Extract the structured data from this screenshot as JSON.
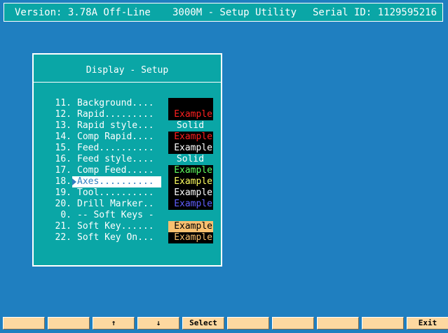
{
  "header": {
    "version": "Version: 3.78A Off-Line",
    "title": "3000M - Setup Utility",
    "serial": "Serial ID: 1129595216"
  },
  "panel": {
    "title": "Display - Setup",
    "items": [
      {
        "num": "11.",
        "label": "Background....",
        "sample_text": "",
        "sample_fg": "#000000",
        "sample_bg": "#000000",
        "selected": false
      },
      {
        "num": "12.",
        "label": "Rapid.........",
        "sample_text": "Example",
        "sample_fg": "#ff2020",
        "sample_bg": "#000000",
        "selected": false
      },
      {
        "num": "13.",
        "label": "Rapid style...",
        "sample_text": "Solid",
        "sample_fg": "#ffffff",
        "sample_bg": "",
        "selected": false
      },
      {
        "num": "14.",
        "label": "Comp Rapid....",
        "sample_text": "Example",
        "sample_fg": "#ff2020",
        "sample_bg": "#000000",
        "selected": false
      },
      {
        "num": "15.",
        "label": "Feed..........",
        "sample_text": "Example",
        "sample_fg": "#ffffff",
        "sample_bg": "#000000",
        "selected": false
      },
      {
        "num": "16.",
        "label": "Feed style....",
        "sample_text": "Solid",
        "sample_fg": "#ffffff",
        "sample_bg": "",
        "selected": false
      },
      {
        "num": "17.",
        "label": "Comp Feed.....",
        "sample_text": "Example",
        "sample_fg": "#60ff60",
        "sample_bg": "#000000",
        "selected": false
      },
      {
        "num": "18.",
        "label": "Axes..........",
        "sample_text": "Example",
        "sample_fg": "#ffff60",
        "sample_bg": "#000000",
        "selected": true
      },
      {
        "num": "19.",
        "label": "Tool..........",
        "sample_text": "Example",
        "sample_fg": "#ffffff",
        "sample_bg": "#000000",
        "selected": false
      },
      {
        "num": "20.",
        "label": "Drill Marker..",
        "sample_text": "Example",
        "sample_fg": "#6060ff",
        "sample_bg": "#000000",
        "selected": false
      },
      {
        "num": "0.",
        "label": "-- Soft Keys -",
        "sample_text": "",
        "sample_fg": "",
        "sample_bg": "",
        "selected": false
      },
      {
        "num": "21.",
        "label": "Soft Key......",
        "sample_text": "Example",
        "sample_fg": "#000000",
        "sample_bg": "#f8c070",
        "selected": false
      },
      {
        "num": "22.",
        "label": "Soft Key On...",
        "sample_text": "Example",
        "sample_fg": "#f8c070",
        "sample_bg": "#000000",
        "selected": false
      }
    ]
  },
  "softkeys": [
    {
      "name": "f1",
      "label": ""
    },
    {
      "name": "f2",
      "label": ""
    },
    {
      "name": "up",
      "label": "↑"
    },
    {
      "name": "down",
      "label": "↓"
    },
    {
      "name": "select",
      "label": "Select"
    },
    {
      "name": "f6",
      "label": ""
    },
    {
      "name": "f7",
      "label": ""
    },
    {
      "name": "f8",
      "label": ""
    },
    {
      "name": "f9",
      "label": ""
    },
    {
      "name": "exit",
      "label": "Exit"
    }
  ],
  "colors": {
    "background": "#1f7fc0",
    "panel": "#0aa6a6",
    "softkey": "#fdd8a0"
  }
}
